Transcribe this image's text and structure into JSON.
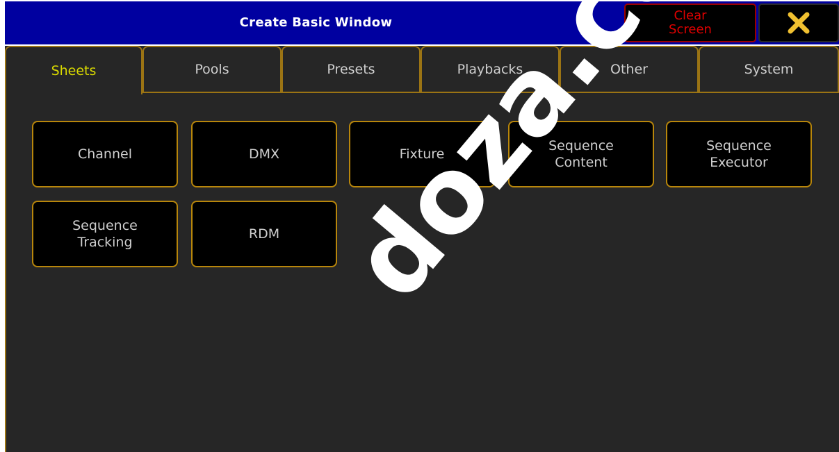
{
  "window": {
    "title": "Create Basic Window",
    "clear_label_line1": "Clear",
    "clear_label_line2": "Screen"
  },
  "tabs": [
    {
      "label": "Sheets",
      "active": true
    },
    {
      "label": "Pools",
      "active": false
    },
    {
      "label": "Presets",
      "active": false
    },
    {
      "label": "Playbacks",
      "active": false
    },
    {
      "label": "Other",
      "active": false
    },
    {
      "label": "System",
      "active": false
    }
  ],
  "buttons": [
    {
      "line1": "Channel",
      "line2": ""
    },
    {
      "line1": "DMX",
      "line2": ""
    },
    {
      "line1": "Fixture",
      "line2": ""
    },
    {
      "line1": "Sequence",
      "line2": "Content"
    },
    {
      "line1": "Sequence",
      "line2": "Executor"
    },
    {
      "line1": "Sequence",
      "line2": "Tracking"
    },
    {
      "line1": "RDM",
      "line2": ""
    }
  ],
  "watermark": {
    "text": "doza.com.m"
  },
  "colors": {
    "title_bar": "#0000a0",
    "accent_border": "#b8860b",
    "active_tab_text": "#d9d900",
    "clear_text": "#e00000",
    "close_icon": "#f0c030",
    "panel_bg": "#262626"
  },
  "icons": {
    "close": "close-icon"
  }
}
